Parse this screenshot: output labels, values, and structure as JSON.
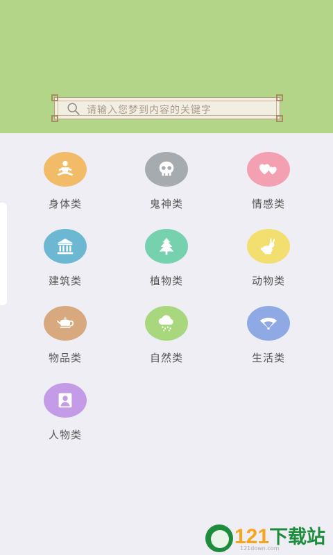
{
  "search": {
    "placeholder": "请输入您梦到内容的关键字"
  },
  "categories": [
    {
      "label": "身体类",
      "icon": "meditation-person-icon",
      "color": "#f1bb67"
    },
    {
      "label": "鬼神类",
      "icon": "skull-icon",
      "color": "#a5abaf"
    },
    {
      "label": "情感类",
      "icon": "hearts-icon",
      "color": "#f2a0b2"
    },
    {
      "label": "建筑类",
      "icon": "temple-building-icon",
      "color": "#6cb8d3"
    },
    {
      "label": "植物类",
      "icon": "pine-tree-icon",
      "color": "#76d1ae"
    },
    {
      "label": "动物类",
      "icon": "rabbit-icon",
      "color": "#f3df6f"
    },
    {
      "label": "物品类",
      "icon": "teapot-icon",
      "color": "#d8a97f"
    },
    {
      "label": "自然类",
      "icon": "rain-cloud-icon",
      "color": "#a9d77e"
    },
    {
      "label": "生活类",
      "icon": "folding-fan-icon",
      "color": "#8ea9e4"
    },
    {
      "label": "人物类",
      "icon": "person-icon",
      "color": "#c49be6"
    }
  ],
  "watermark": {
    "number": "121",
    "text": "下载站",
    "sub": "121down.com"
  }
}
